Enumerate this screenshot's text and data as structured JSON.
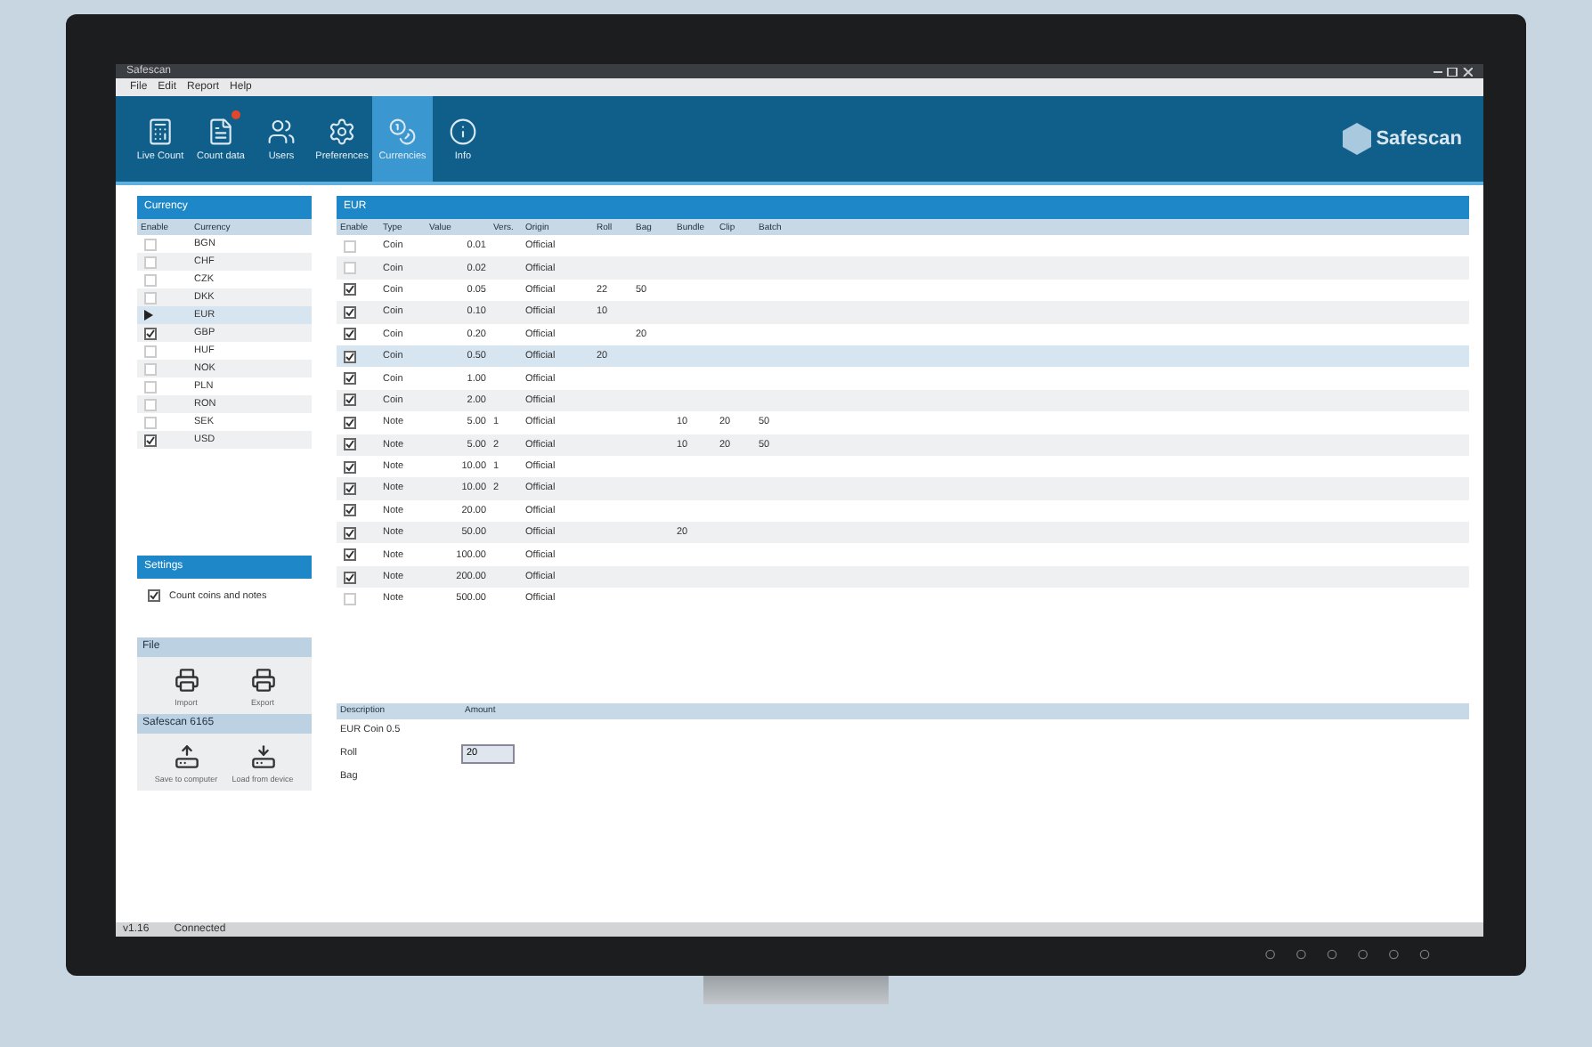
{
  "window": {
    "title": "Safescan"
  },
  "menu": [
    "File",
    "Edit",
    "Report",
    "Help"
  ],
  "toolbar": [
    {
      "label": "Live Count",
      "selected": false,
      "alert": false
    },
    {
      "label": "Count data",
      "selected": false,
      "alert": true
    },
    {
      "label": "Users",
      "selected": false,
      "alert": false
    },
    {
      "label": "Preferences",
      "selected": false,
      "alert": false
    },
    {
      "label": "Currencies",
      "selected": true,
      "alert": false
    },
    {
      "label": "Info",
      "selected": false,
      "alert": false
    }
  ],
  "brand": "Safescan",
  "currency_panel": {
    "title": "Currency",
    "columns": [
      "Enable",
      "Currency"
    ],
    "rows": [
      {
        "code": "BGN",
        "enabled": false,
        "selected": false
      },
      {
        "code": "CHF",
        "enabled": false,
        "selected": false
      },
      {
        "code": "CZK",
        "enabled": false,
        "selected": false
      },
      {
        "code": "DKK",
        "enabled": false,
        "selected": false
      },
      {
        "code": "EUR",
        "selected": true
      },
      {
        "code": "GBP",
        "enabled": true,
        "selected": false
      },
      {
        "code": "HUF",
        "enabled": false,
        "selected": false
      },
      {
        "code": "NOK",
        "enabled": false,
        "selected": false
      },
      {
        "code": "PLN",
        "enabled": false,
        "selected": false
      },
      {
        "code": "RON",
        "enabled": false,
        "selected": false
      },
      {
        "code": "SEK",
        "enabled": false,
        "selected": false
      },
      {
        "code": "USD",
        "enabled": true,
        "selected": false
      }
    ]
  },
  "denominations": {
    "title": "EUR",
    "columns": [
      "Enable",
      "Type",
      "Value",
      "Vers.",
      "Origin",
      "Roll",
      "Bag",
      "Bundle",
      "Clip",
      "Batch"
    ],
    "rows": [
      {
        "enabled": false,
        "type": "Coin",
        "value": "0.01",
        "origin": "Official",
        "selected": false
      },
      {
        "enabled": false,
        "type": "Coin",
        "value": "0.02",
        "origin": "Official",
        "selected": false
      },
      {
        "enabled": true,
        "type": "Coin",
        "value": "0.05",
        "origin": "Official",
        "roll": "22",
        "bag": "50",
        "selected": false
      },
      {
        "enabled": true,
        "type": "Coin",
        "value": "0.10",
        "origin": "Official",
        "roll": "10",
        "selected": false
      },
      {
        "enabled": true,
        "type": "Coin",
        "value": "0.20",
        "origin": "Official",
        "bag": "20",
        "selected": false
      },
      {
        "enabled": true,
        "type": "Coin",
        "value": "0.50",
        "origin": "Official",
        "roll": "20",
        "selected": true
      },
      {
        "enabled": true,
        "type": "Coin",
        "value": "1.00",
        "origin": "Official",
        "selected": false
      },
      {
        "enabled": true,
        "type": "Coin",
        "value": "2.00",
        "origin": "Official",
        "selected": false
      },
      {
        "enabled": true,
        "type": "Note",
        "value": "5.00",
        "version": "1",
        "origin": "Official",
        "bundle": "10",
        "clip": "20",
        "batch": "50",
        "selected": false
      },
      {
        "enabled": true,
        "type": "Note",
        "value": "5.00",
        "version": "2",
        "origin": "Official",
        "bundle": "10",
        "clip": "20",
        "batch": "50",
        "selected": false
      },
      {
        "enabled": true,
        "type": "Note",
        "value": "10.00",
        "version": "1",
        "origin": "Official",
        "selected": false
      },
      {
        "enabled": true,
        "type": "Note",
        "value": "10.00",
        "version": "2",
        "origin": "Official",
        "selected": false
      },
      {
        "enabled": true,
        "type": "Note",
        "value": "20.00",
        "origin": "Official",
        "selected": false
      },
      {
        "enabled": true,
        "type": "Note",
        "value": "50.00",
        "origin": "Official",
        "bundle": "20",
        "selected": false
      },
      {
        "enabled": true,
        "type": "Note",
        "value": "100.00",
        "origin": "Official",
        "selected": false
      },
      {
        "enabled": true,
        "type": "Note",
        "value": "200.00",
        "origin": "Official",
        "selected": false
      },
      {
        "enabled": false,
        "type": "Note",
        "value": "500.00",
        "origin": "Official",
        "selected": false
      }
    ]
  },
  "settings": {
    "title": "Settings",
    "options": [
      {
        "label": "Count coins and notes",
        "checked": true
      }
    ]
  },
  "file_panel": {
    "title": "File",
    "actions": [
      "Import",
      "Export"
    ]
  },
  "device_panel": {
    "title": "Safescan 6165",
    "actions": [
      "Save to computer",
      "Load from device"
    ]
  },
  "details": {
    "columns": [
      "Description",
      "Amount"
    ],
    "rows": [
      {
        "kind": "text",
        "label": "EUR Coin 0.5"
      },
      {
        "kind": "input",
        "label": "Roll",
        "value": "20"
      },
      {
        "kind": "text",
        "label": "Bag"
      }
    ]
  },
  "status_bar": {
    "version": "v1.16",
    "status": "Connected"
  }
}
